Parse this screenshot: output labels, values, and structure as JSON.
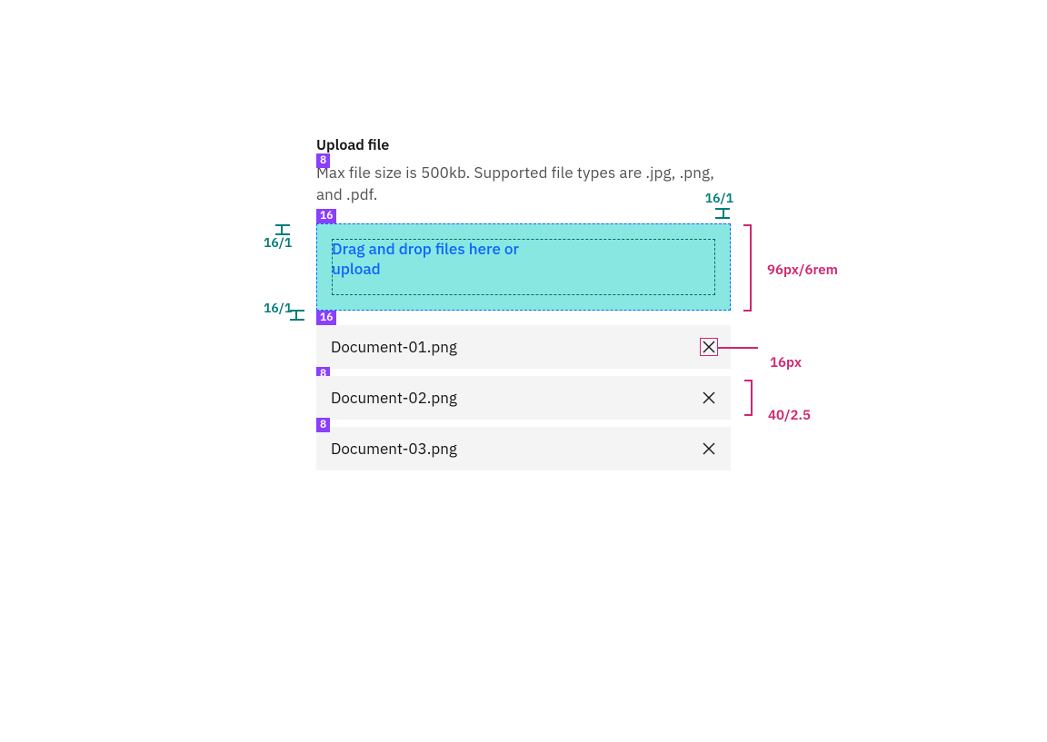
{
  "label": "Upload file",
  "description": "Max file size is 500kb. Supported file types are .jpg, .png, and .pdf.",
  "dropzone_text": "Drag and drop files here or upload",
  "files": [
    {
      "name": "Document-01.png"
    },
    {
      "name": "Document-02.png"
    },
    {
      "name": "Document-03.png"
    }
  ],
  "specs": {
    "gap_label_desc": "8",
    "gap_desc_drop": "16",
    "gap_drop_files": "16",
    "gap_file_file_1": "8",
    "gap_file_file_2": "8",
    "padding_top": "16/1",
    "padding_bottom": "16/1",
    "padding_right": "16/1",
    "dropzone_height": "96px/6rem",
    "close_icon_size": "16px",
    "file_row_height": "40/2.5"
  }
}
